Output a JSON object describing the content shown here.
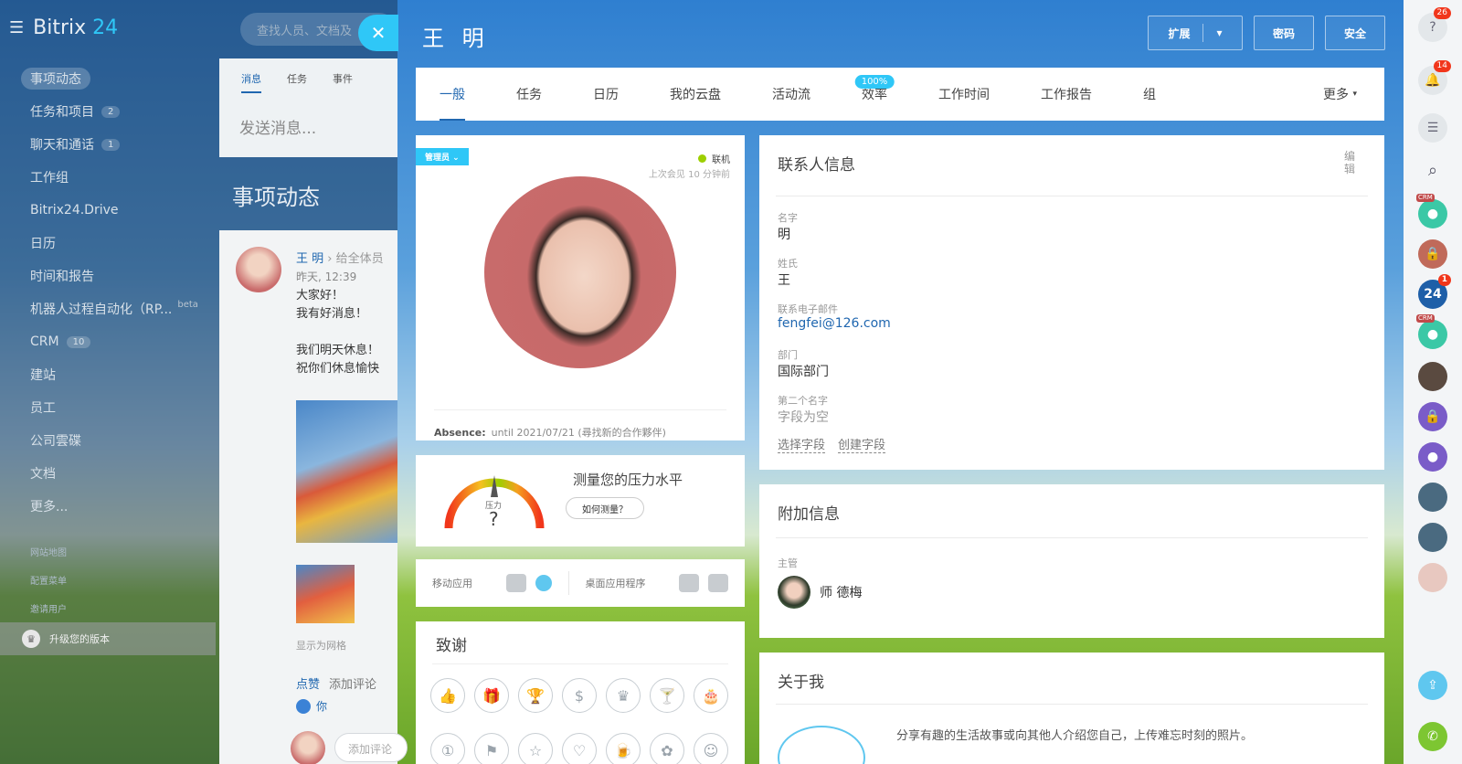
{
  "nav": {
    "logo_prefix": "Bitrix",
    "logo_num": "24",
    "items": [
      {
        "label": "事项动态",
        "count": ""
      },
      {
        "label": "任务和项目",
        "count": "2"
      },
      {
        "label": "聊天和通话",
        "count": "1"
      },
      {
        "label": "工作组",
        "count": ""
      },
      {
        "label": "Bitrix24.Drive",
        "count": ""
      },
      {
        "label": "日历",
        "count": ""
      },
      {
        "label": "时间和报告",
        "count": ""
      },
      {
        "label": "机器人过程自动化（RP...",
        "count": ""
      },
      {
        "label": "CRM",
        "count": "10"
      },
      {
        "label": "建站",
        "count": ""
      },
      {
        "label": "员工",
        "count": ""
      },
      {
        "label": "公司雲碟",
        "count": ""
      },
      {
        "label": "文档",
        "count": ""
      },
      {
        "label": "更多...",
        "count": ""
      }
    ],
    "beta": "beta",
    "small_links": [
      "网站地图",
      "配置菜单",
      "邀请用户"
    ],
    "upgrade": "升级您的版本"
  },
  "search": {
    "placeholder": "查找人员、文档及"
  },
  "feed": {
    "tabs": [
      "消息",
      "任务",
      "事件"
    ],
    "send_placeholder": "发送消息...",
    "title": "事项动态",
    "post": {
      "author": "王 明",
      "to": "给全体员",
      "time": "昨天, 12:39",
      "lines": [
        "大家好！",
        "我有好消息！",
        "",
        "我们明天休息！",
        "祝你们休息愉快"
      ],
      "grid_label": "显示为网格",
      "like": "点赞",
      "comment": "添加评论",
      "you": "你",
      "add_comment": "添加评论"
    }
  },
  "profile": {
    "name": "王 明",
    "buttons": {
      "expand": "扩展",
      "password": "密码",
      "security": "安全"
    },
    "tabs": [
      {
        "label": "一般",
        "badge": ""
      },
      {
        "label": "任务",
        "badge": ""
      },
      {
        "label": "日历",
        "badge": ""
      },
      {
        "label": "我的云盘",
        "badge": ""
      },
      {
        "label": "活动流",
        "badge": ""
      },
      {
        "label": "效率",
        "badge": "100%"
      },
      {
        "label": "工作时间",
        "badge": ""
      },
      {
        "label": "工作报告",
        "badge": ""
      },
      {
        "label": "组",
        "badge": ""
      }
    ],
    "more_tab": "更多",
    "role": "管理员",
    "status": "联机",
    "last_seen": "上次会见 10 分钟前",
    "absence_label": "Absence:",
    "absence_value": "until 2021/07/21 (尋找新的合作夥伴)",
    "stress_title": "测量您的压力水平",
    "stress_button": "如何测量？",
    "stress_gauge_label": "压力",
    "stress_gauge_value": "?",
    "mobile_app": "移动应用",
    "desktop_app": "桌面应用程序",
    "thanks_title": "致谢",
    "contact": {
      "title": "联系人信息",
      "edit": "编辑",
      "fields": [
        {
          "label": "名字",
          "value": "明"
        },
        {
          "label": "姓氏",
          "value": "王"
        },
        {
          "label": "联系电子邮件",
          "value": "fengfei@126.com"
        },
        {
          "label": "部门",
          "value": "国际部门"
        },
        {
          "label": "第二个名字",
          "value": "字段为空"
        }
      ],
      "select_field": "选择字段",
      "create_field": "创建字段"
    },
    "extra": {
      "title": "附加信息",
      "manager_label": "主管",
      "manager_name": "师 德梅"
    },
    "about": {
      "title": "关于我",
      "text": "分享有趣的生活故事或向其他人介绍您自己，上传难忘时刻的照片。"
    }
  },
  "rightbar": {
    "help_badge": "26",
    "bell_badge": "14",
    "b24_badge": "1",
    "b24_label": "24",
    "crm_tag": "CRM"
  },
  "colors": {
    "accent": "#2fc7f7",
    "link": "#2067b0",
    "online": "#9dcf00",
    "badge": "#f1361b"
  }
}
